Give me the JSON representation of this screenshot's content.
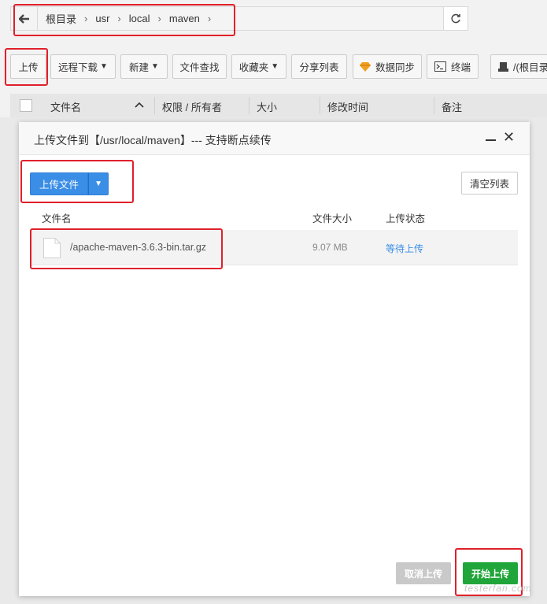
{
  "address_bar": {
    "breadcrumbs": [
      "根目录",
      "usr",
      "local",
      "maven"
    ]
  },
  "toolbar": {
    "upload": "上传",
    "remote_download": "远程下载",
    "new": "新建",
    "file_search": "文件查找",
    "favorites": "收藏夹",
    "share_list": "分享列表",
    "data_sync": "数据同步",
    "terminal": "终端",
    "root_dir": "/(根目录"
  },
  "table_header": {
    "filename": "文件名",
    "permission": "权限 / 所有者",
    "size": "大小",
    "modified": "修改时间",
    "remark": "备注"
  },
  "modal": {
    "title": "上传文件到【/usr/local/maven】--- 支持断点续传",
    "upload_files_btn": "上传文件",
    "clear_list_btn": "清空列表",
    "col_filename": "文件名",
    "col_size": "文件大小",
    "col_status": "上传状态",
    "files": [
      {
        "name": "/apache-maven-3.6.3-bin.tar.gz",
        "size": "9.07 MB",
        "status": "等待上传"
      }
    ],
    "cancel_btn": "取消上传",
    "start_btn": "开始上传"
  },
  "watermark": "testerfan.com",
  "colors": {
    "primary_blue": "#3a8ee6",
    "start_green": "#20a53a",
    "highlight_red": "#e0202a"
  }
}
